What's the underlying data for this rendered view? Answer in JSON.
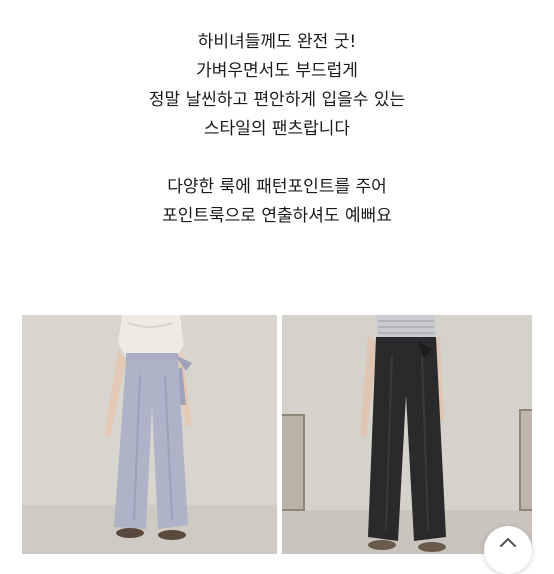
{
  "description": {
    "lines": [
      "하비녀들께도 완전 굿!",
      "가벼우면서도 부드럽게",
      "정말 날씬하고 편안하게 입을수 있는",
      "스타일의 팬츠랍니다",
      "다양한 룩에 패턴포인트를 주어",
      "포인트룩으로 연출하셔도 예뻐요"
    ]
  },
  "photos": [
    {
      "icon": "product-photo-lavender-pants",
      "colors": {
        "pants": "#aeb3c8",
        "top": "#eeeae4",
        "wall": "#d8d4ce"
      }
    },
    {
      "icon": "product-photo-black-pants",
      "colors": {
        "pants": "#2a2a2c",
        "top": "#c9cbd0",
        "wall": "#d5d1cb"
      }
    }
  ],
  "scroll_top_button": {
    "icon": "chevron-up-icon"
  }
}
